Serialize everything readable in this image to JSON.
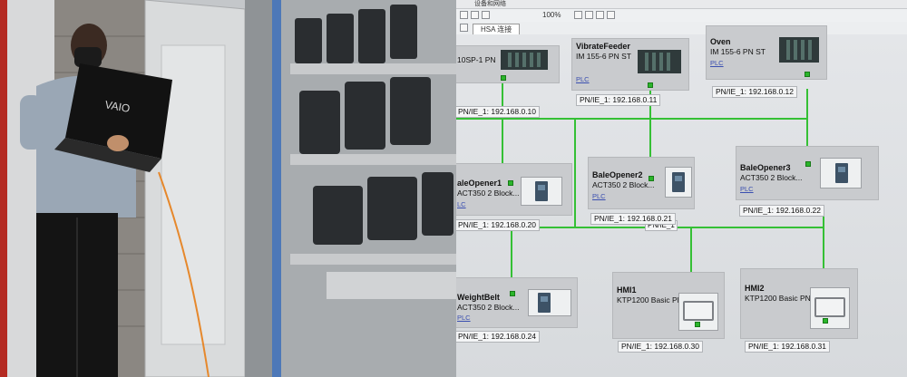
{
  "photo": {
    "laptop_logo": "VAIO"
  },
  "screen": {
    "window_title": "设备和网络",
    "toolbar_zoom": "100%",
    "view_label": "HSA 连接",
    "network_label": "PN/IE_1",
    "devices": [
      {
        "name": "",
        "sub": "10SP-1 PN",
        "ip": "PN/IE_1: 192.168.0.10"
      },
      {
        "name": "VibrateFeeder",
        "sub": "IM 155-6 PN ST",
        "plc": "PLC",
        "ip": "PN/IE_1: 192.168.0.11"
      },
      {
        "name": "Oven",
        "sub": "IM 155-6 PN ST",
        "plc": "PLC",
        "ip": "PN/IE_1: 192.168.0.12"
      },
      {
        "name": "aleOpener1",
        "sub": "ACT350 2 Block...",
        "plc": "LC",
        "ip": "PN/IE_1: 192.168.0.20"
      },
      {
        "name": "BaleOpener2",
        "sub": "ACT350 2 Block...",
        "plc": "PLC",
        "ip": "PN/IE_1: 192.168.0.21"
      },
      {
        "name": "BaleOpener3",
        "sub": "ACT350 2 Block...",
        "plc": "PLC",
        "ip": "PN/IE_1: 192.168.0.22"
      },
      {
        "name": "WeightBelt",
        "sub": "ACT350 2 Block...",
        "plc": "PLC",
        "ip": "PN/IE_1: 192.168.0.24"
      },
      {
        "name": "HMI1",
        "sub": "KTP1200 Basic PN",
        "ip": "PN/IE_1: 192.168.0.30"
      },
      {
        "name": "HMI2",
        "sub": "KTP1200 Basic PN",
        "ip": "PN/IE_1: 192.168.0.31"
      }
    ]
  }
}
